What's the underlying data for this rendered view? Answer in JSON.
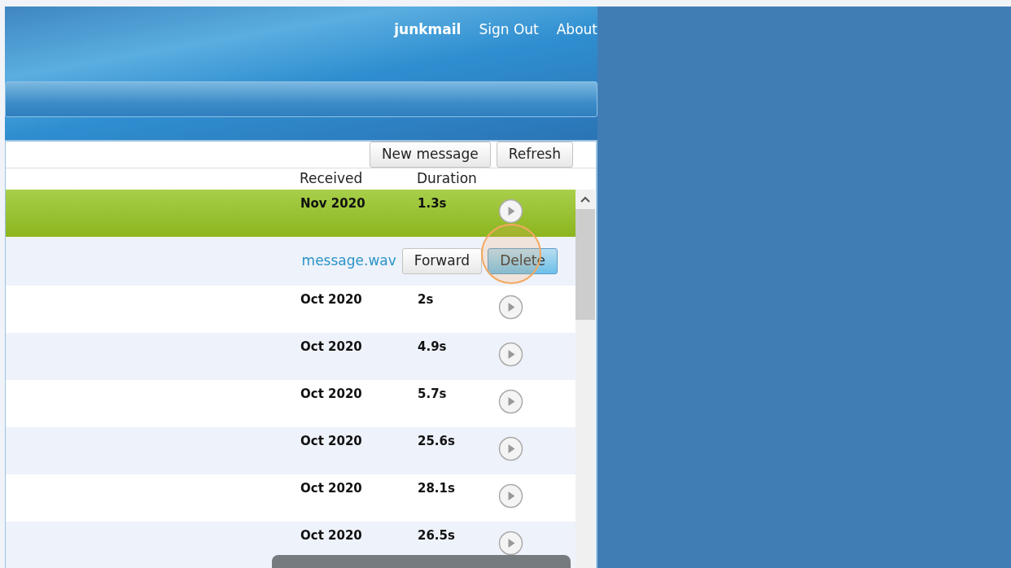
{
  "header": {
    "user": "junkmail",
    "links": [
      "Sign Out",
      "About"
    ]
  },
  "toolbar": {
    "buttons": [
      "New message",
      "Refresh"
    ]
  },
  "table": {
    "columns": [
      "Received",
      "Duration"
    ],
    "rows": [
      {
        "kind": "message",
        "received": "Nov 2020",
        "duration": "1.3s",
        "selected": true
      },
      {
        "kind": "actions",
        "file_link": "message.wav",
        "buttons": [
          {
            "label": "Forward",
            "selected": false
          },
          {
            "label": "Delete",
            "selected": true
          }
        ]
      },
      {
        "kind": "message",
        "received": "Oct 2020",
        "duration": "2s",
        "selected": false
      },
      {
        "kind": "message",
        "received": "Oct 2020",
        "duration": "4.9s",
        "selected": false
      },
      {
        "kind": "message",
        "received": "Oct 2020",
        "duration": "5.7s",
        "selected": false
      },
      {
        "kind": "message",
        "received": "Oct 2020",
        "duration": "25.6s",
        "selected": false
      },
      {
        "kind": "message",
        "received": "Oct 2020",
        "duration": "28.1s",
        "selected": false
      },
      {
        "kind": "message",
        "received": "Oct 2020",
        "duration": "26.5s",
        "selected": false
      }
    ]
  }
}
